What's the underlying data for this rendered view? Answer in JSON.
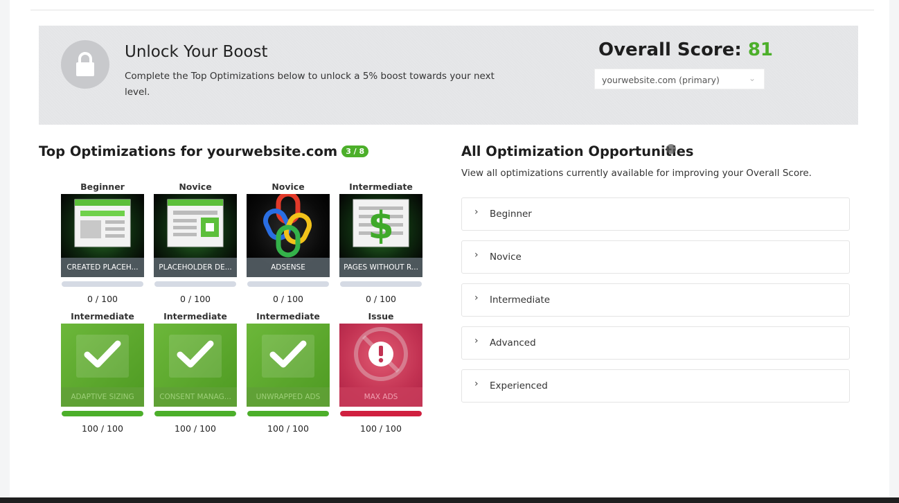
{
  "banner": {
    "title": "Unlock Your Boost",
    "description": "Complete the Top Optimizations below to unlock a 5% boost towards your next level.",
    "score_label": "Overall Score:",
    "score_value": "81",
    "site_select": "yourwebsite.com (primary)"
  },
  "top_optimizations": {
    "title": "Top Optimizations for yourwebsite.com",
    "badge": "3 / 8",
    "cards": [
      {
        "level": "Beginner",
        "caption": "CREATED PLACEH...",
        "score": "0 / 100",
        "progress": 0,
        "style": "dark",
        "icon": "placeholder-page-icon"
      },
      {
        "level": "Novice",
        "caption": "PLACEHOLDER DE...",
        "score": "0 / 100",
        "progress": 0,
        "style": "dark",
        "icon": "placeholder-ad-page-icon"
      },
      {
        "level": "Novice",
        "caption": "ADSENSE",
        "score": "0 / 100",
        "progress": 0,
        "style": "dark-black",
        "icon": "chain-link-icon"
      },
      {
        "level": "Intermediate",
        "caption": "PAGES WITHOUT R...",
        "score": "0 / 100",
        "progress": 0,
        "style": "dark",
        "icon": "dollar-page-icon"
      },
      {
        "level": "Intermediate",
        "caption": "ADAPTIVE SIZING",
        "score": "100 / 100",
        "progress": 100,
        "style": "green",
        "icon": "check-icon"
      },
      {
        "level": "Intermediate",
        "caption": "CONSENT MANAG...",
        "score": "100 / 100",
        "progress": 100,
        "style": "green",
        "icon": "check-icon"
      },
      {
        "level": "Intermediate",
        "caption": "UNWRAPPED ADS",
        "score": "100 / 100",
        "progress": 100,
        "style": "green",
        "icon": "check-icon"
      },
      {
        "level": "Issue",
        "caption": "MAX ADS",
        "score": "100 / 100",
        "progress": 100,
        "style": "red",
        "icon": "alert-icon"
      }
    ]
  },
  "all_opportunities": {
    "title": "All Optimization Opportunities",
    "description": "View all optimizations currently available for improving your Overall Score.",
    "items": [
      "Beginner",
      "Novice",
      "Intermediate",
      "Advanced",
      "Experienced"
    ]
  },
  "colors": {
    "accent_green": "#4caf2a",
    "issue_red": "#d0203f"
  }
}
